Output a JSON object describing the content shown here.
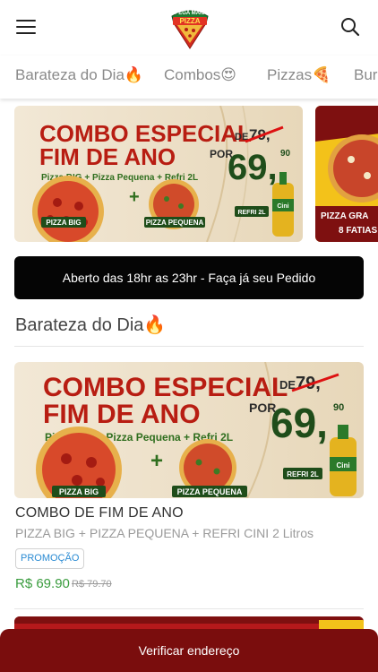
{
  "header": {
    "menu_icon": "hamburger-menu-icon",
    "logo_text_top": "PEGA MAIS",
    "logo_text_main": "PIZZA",
    "search_icon": "search-icon"
  },
  "categories": [
    {
      "label": "Barateza do Dia🔥"
    },
    {
      "label": "Combos😍"
    },
    {
      "label": "Pizzas🍕"
    },
    {
      "label": "Bur"
    }
  ],
  "carousel": {
    "slide1": {
      "headline1": "COMBO ESPECIAL",
      "headline2": "FIM DE ANO",
      "subline": "Pizza BIG + Pizza Pequena + Refri 2L",
      "price_from_label": "DE",
      "price_old": "79,",
      "price_old_cents": "90",
      "price_por_label": "POR",
      "price_new": "69,",
      "price_new_cents": "90",
      "label_big": "PIZZA BIG",
      "label_small": "PIZZA PEQUENA",
      "label_refri": "REFRI 2L",
      "bottle_brand": "Cini"
    },
    "slide2": {
      "label1": "PIZZA GRA",
      "label2": "8 FATIAS"
    }
  },
  "banner": {
    "text": "Aberto das 18hr as 23hr - Faça já seu Pedido"
  },
  "section": {
    "title": "Barateza do Dia🔥"
  },
  "product": {
    "name": "COMBO DE FIM DE ANO",
    "description": "PIZZA BIG + PIZZA PEQUENA + REFRI CINI 2 Litros",
    "badge": "PROMOÇÃO",
    "price": "R$ 69.90",
    "old_price": "R$ 79.70"
  },
  "footer": {
    "button_label": "Verificar endereço"
  },
  "colors": {
    "banner_bg": "#050505",
    "bottom_button_bg": "#7a0d0d",
    "price_green": "#3a9c3e",
    "badge_blue": "#2a8bd3",
    "promo_red": "#b81d12",
    "promo_yellow": "#f3c21a"
  }
}
